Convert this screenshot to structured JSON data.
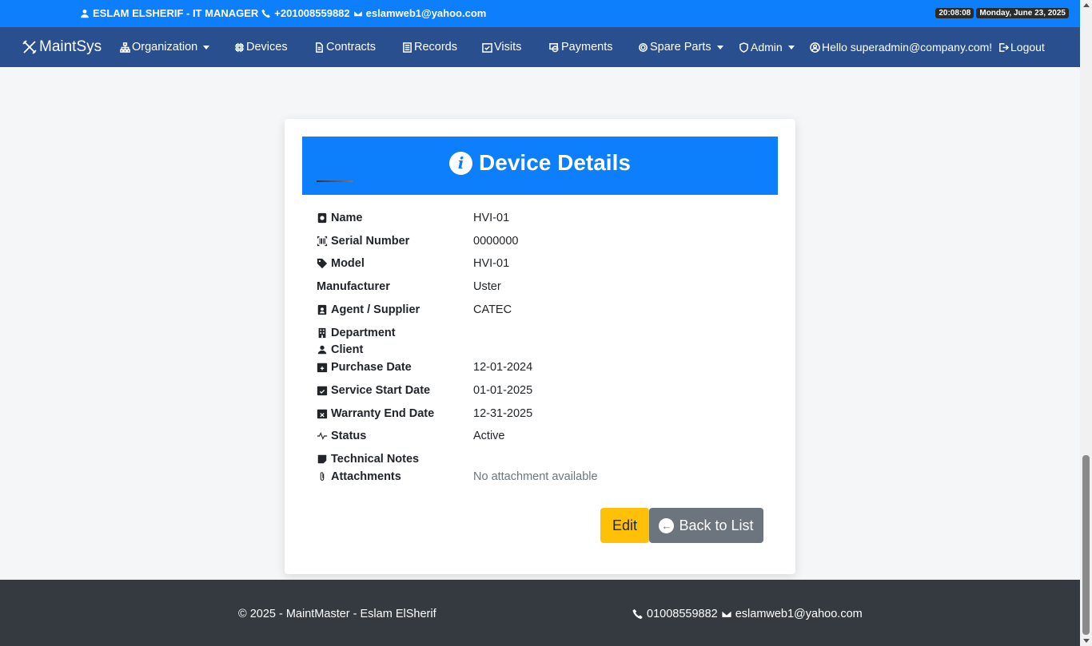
{
  "topbar": {
    "contact_name": "ESLAM ELSHERIF - IT MANAGER",
    "phone": "+201008559882",
    "email": "eslamweb1@yahoo.com",
    "time": "20:08:08",
    "date": "Monday, June 23, 2025"
  },
  "nav": {
    "brand": "MaintSys",
    "items": [
      {
        "label": "Organization",
        "icon": "sitemap-icon",
        "dropdown": true
      },
      {
        "label": "Devices",
        "icon": "cpu-icon",
        "dropdown": false
      },
      {
        "label": "Contracts",
        "icon": "file-icon",
        "dropdown": false
      },
      {
        "label": "Records",
        "icon": "list-icon",
        "dropdown": false
      },
      {
        "label": "Visits",
        "icon": "calendar-check-icon",
        "dropdown": false
      },
      {
        "label": "Payments",
        "icon": "cash-icon",
        "dropdown": false
      },
      {
        "label": "Spare Parts",
        "icon": "gear-icon",
        "dropdown": true
      },
      {
        "label": "Admin",
        "icon": "shield-icon",
        "dropdown": true
      }
    ],
    "greeting": "Hello superadmin@company.com!",
    "logout": "Logout"
  },
  "card": {
    "title": "Device Details",
    "fields": [
      {
        "label": "Name",
        "value": "HVI-01",
        "icon": "device-icon"
      },
      {
        "label": "Serial Number",
        "value": "0000000",
        "icon": "barcode-icon"
      },
      {
        "label": "Model",
        "value": "HVI-01",
        "icon": "tag-icon"
      },
      {
        "label": "Manufacturer",
        "value": "Uster",
        "icon": ""
      },
      {
        "label": "Agent / Supplier",
        "value": "CATEC",
        "icon": "person-badge-icon"
      },
      {
        "label": "Department",
        "value": "",
        "icon": "building-icon"
      },
      {
        "label": "Client",
        "value": "",
        "icon": "person-icon"
      },
      {
        "label": "Purchase Date",
        "value": "12-01-2024",
        "icon": "calendar-plus-icon"
      },
      {
        "label": "Service Start Date",
        "value": "01-01-2025",
        "icon": "calendar-check-icon"
      },
      {
        "label": "Warranty End Date",
        "value": "12-31-2025",
        "icon": "calendar-x-icon"
      },
      {
        "label": "Status",
        "value": "Active",
        "icon": "activity-icon"
      },
      {
        "label": "Technical Notes",
        "value": "",
        "icon": "sticky-note-icon"
      },
      {
        "label": "Attachments",
        "value": "No attachment available",
        "icon": "paperclip-icon"
      }
    ],
    "edit_label": "Edit",
    "back_label": "Back to List"
  },
  "footer": {
    "copyright": "© 2025 - MaintMaster - Eslam ElSherif",
    "phone": "01008559882",
    "email": "eslamweb1@yahoo.com"
  },
  "colors": {
    "primary": "#0d7ffd",
    "navbar": "#2a4f8f",
    "footer": "#343a40",
    "edit_button": "#ffc107",
    "back_button": "#6c757d"
  }
}
